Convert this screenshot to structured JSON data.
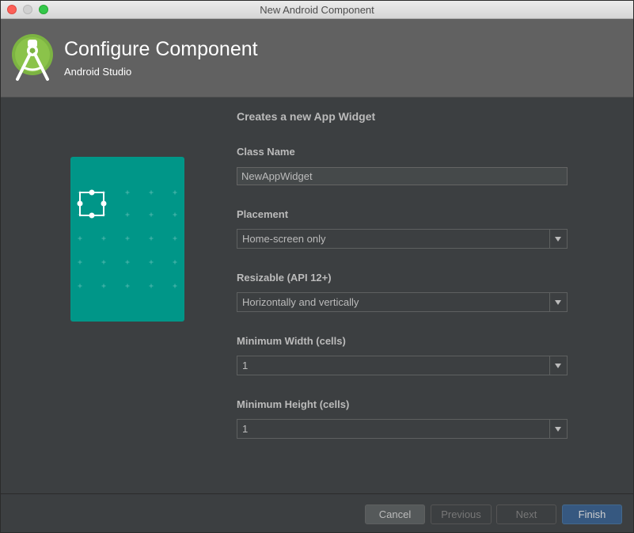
{
  "window": {
    "title": "New Android Component"
  },
  "header": {
    "title": "Configure Component",
    "subtitle": "Android Studio",
    "logo_icon": "android-studio-logo-icon"
  },
  "form": {
    "description": "Creates a new App Widget",
    "class_name": {
      "label": "Class Name",
      "value": "NewAppWidget"
    },
    "placement": {
      "label": "Placement",
      "value": "Home-screen only"
    },
    "resizable": {
      "label": "Resizable (API 12+)",
      "value": "Horizontally and vertically"
    },
    "min_width": {
      "label": "Minimum Width (cells)",
      "value": "1"
    },
    "min_height": {
      "label": "Minimum Height (cells)",
      "value": "1"
    }
  },
  "footer": {
    "cancel": "Cancel",
    "previous": "Previous",
    "next": "Next",
    "finish": "Finish"
  },
  "colors": {
    "preview_bg": "#009688",
    "finish_button": "#365880",
    "header_bg": "#616161",
    "dialog_bg": "#3c3f41"
  }
}
